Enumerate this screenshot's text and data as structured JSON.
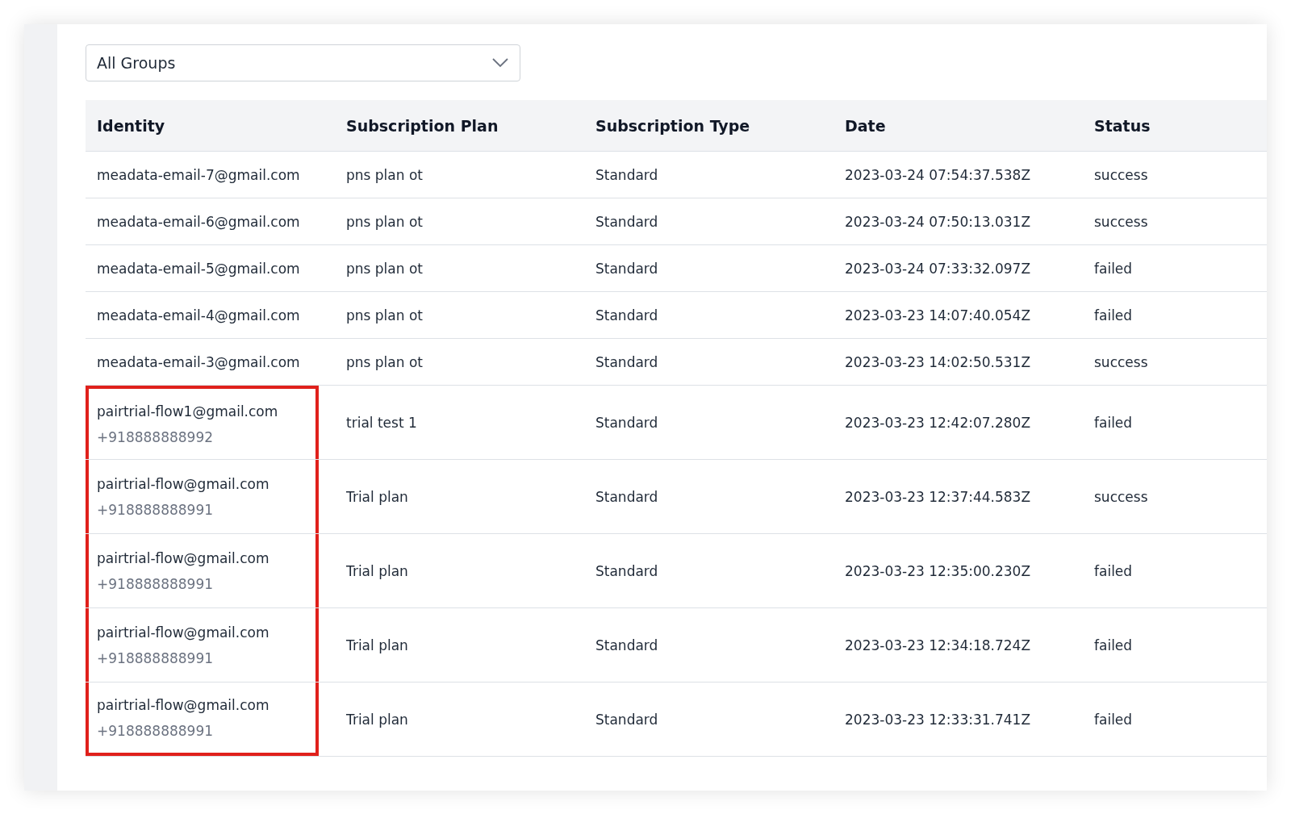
{
  "filter": {
    "value": "All Groups"
  },
  "table": {
    "columns": [
      "Identity",
      "Subscription Plan",
      "Subscription Type",
      "Date",
      "Status"
    ],
    "rows": [
      {
        "identity": "meadata-email-7@gmail.com",
        "plan": "pns plan ot",
        "type": "Standard",
        "date": "2023-03-24 07:54:37.538Z",
        "status": "success",
        "highlighted": false
      },
      {
        "identity": "meadata-email-6@gmail.com",
        "plan": "pns plan ot",
        "type": "Standard",
        "date": "2023-03-24 07:50:13.031Z",
        "status": "success",
        "highlighted": false
      },
      {
        "identity": "meadata-email-5@gmail.com",
        "plan": "pns plan ot",
        "type": "Standard",
        "date": "2023-03-24 07:33:32.097Z",
        "status": "failed",
        "highlighted": false
      },
      {
        "identity": "meadata-email-4@gmail.com",
        "plan": "pns plan ot",
        "type": "Standard",
        "date": "2023-03-23 14:07:40.054Z",
        "status": "failed",
        "highlighted": false
      },
      {
        "identity": "meadata-email-3@gmail.com",
        "plan": "pns plan ot",
        "type": "Standard",
        "date": "2023-03-23 14:02:50.531Z",
        "status": "success",
        "highlighted": false
      },
      {
        "identity": "pairtrial-flow1@gmail.com",
        "phone": "+918888888992",
        "plan": "trial test 1",
        "type": "Standard",
        "date": "2023-03-23 12:42:07.280Z",
        "status": "failed",
        "highlighted": true
      },
      {
        "identity": "pairtrial-flow@gmail.com",
        "phone": "+918888888991",
        "plan": "Trial plan",
        "type": "Standard",
        "date": "2023-03-23 12:37:44.583Z",
        "status": "success",
        "highlighted": true
      },
      {
        "identity": "pairtrial-flow@gmail.com",
        "phone": "+918888888991",
        "plan": "Trial plan",
        "type": "Standard",
        "date": "2023-03-23 12:35:00.230Z",
        "status": "failed",
        "highlighted": true
      },
      {
        "identity": "pairtrial-flow@gmail.com",
        "phone": "+918888888991",
        "plan": "Trial plan",
        "type": "Standard",
        "date": "2023-03-23 12:34:18.724Z",
        "status": "failed",
        "highlighted": true
      },
      {
        "identity": "pairtrial-flow@gmail.com",
        "phone": "+918888888991",
        "plan": "Trial plan",
        "type": "Standard",
        "date": "2023-03-23 12:33:31.741Z",
        "status": "failed",
        "highlighted": true
      }
    ]
  }
}
